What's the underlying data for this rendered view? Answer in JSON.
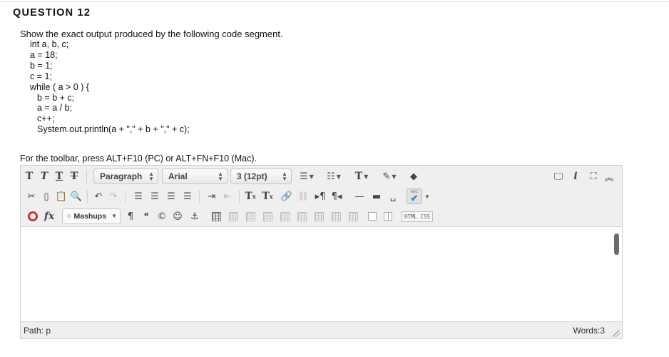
{
  "question": {
    "title": "QUESTION 12",
    "prompt": "Show the exact output produced by the following code segment.",
    "code_lines": [
      "int a, b, c;",
      "a = 18;",
      "b = 1;",
      "c = 1;",
      "while ( a > 0 ) {",
      "b = b + c;",
      "a = a / b;",
      "c++;",
      "System.out.println(a + \",\" + b + \",\" + c);"
    ],
    "toolbar_hint": "For the toolbar, press ALT+F10 (PC) or ALT+FN+F10 (Mac)."
  },
  "toolbar": {
    "row1": {
      "text_bold": "T",
      "text_italic": "T",
      "text_underline": "T",
      "text_strike": "T",
      "format_select": "Paragraph",
      "font_select": "Arial",
      "size_select": "3 (12pt)",
      "text_color": "T",
      "info_icon": "i"
    },
    "row2": {
      "superscript": "T",
      "subscript": "T",
      "spellcheck_label": "ABC"
    },
    "row3": {
      "fx_label": "fx",
      "mashups_label": "Mashups",
      "html_css_label": "HTML CSS"
    }
  },
  "statusbar": {
    "path": "Path: p",
    "words": "Words:3"
  },
  "colors": {
    "toolbar_bg": "#efefef",
    "accent_blue": "#3d7bc7",
    "record_red": "#d23030"
  }
}
